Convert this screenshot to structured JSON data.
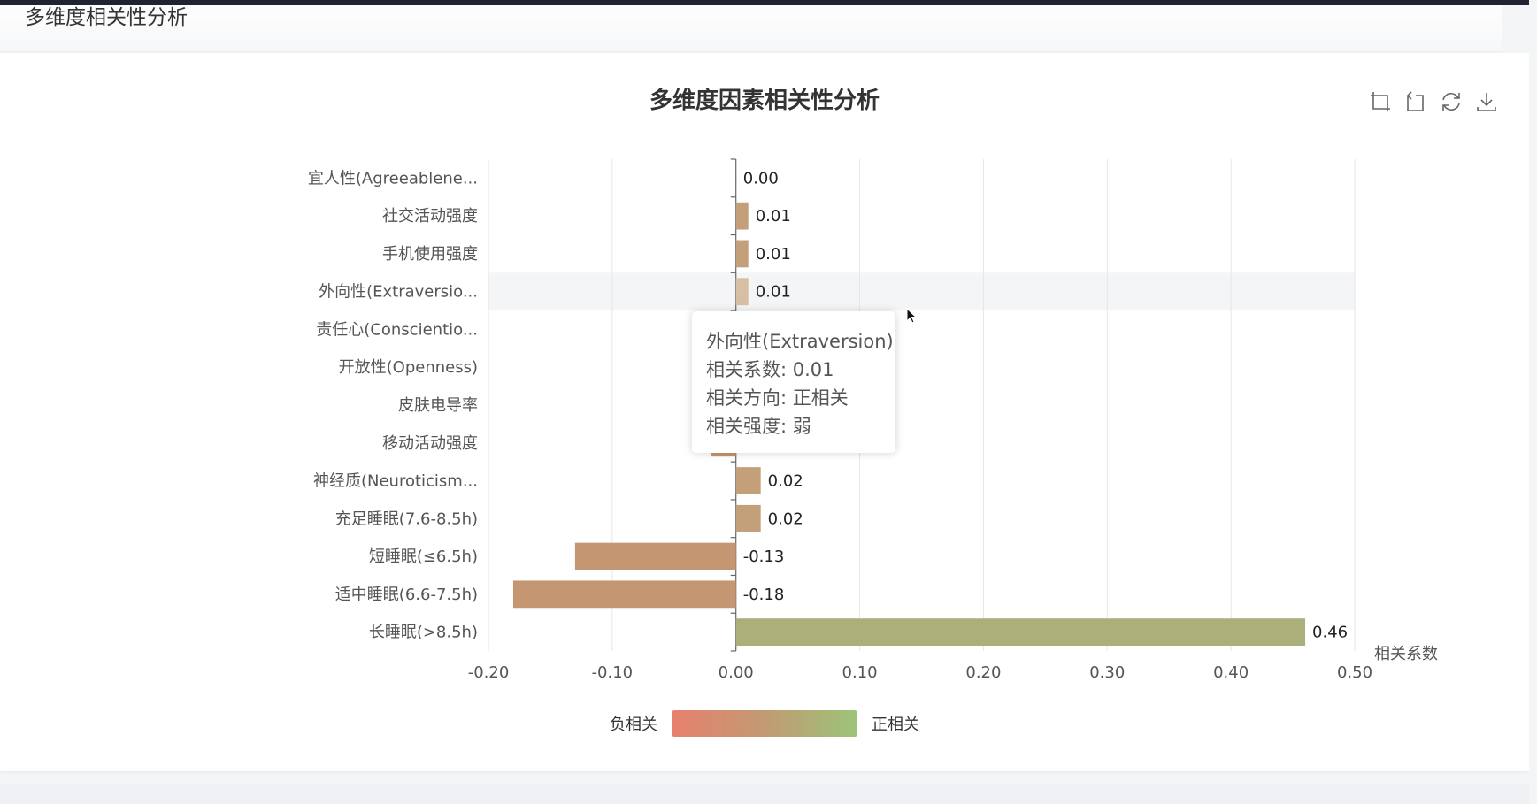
{
  "page": {
    "section_title": "多维度相关性分析"
  },
  "toolbox": [
    {
      "name": "zoom-icon"
    },
    {
      "name": "zoom-reset-icon"
    },
    {
      "name": "refresh-icon"
    },
    {
      "name": "download-icon"
    }
  ],
  "tooltip": {
    "title": "外向性(Extraversion)",
    "line1": "相关系数: 0.01",
    "line2": "相关方向: 正相关",
    "line3": "相关强度: 弱"
  },
  "legend": {
    "low_label": "负相关",
    "high_label": "正相关",
    "low_color": "#e8806e",
    "mid_color": "#c29a72",
    "high_color": "#9cc47a"
  },
  "colors": {
    "bar_positive": "#c3a07a",
    "bar_negative": "#c49672",
    "bar_strong_positive": "#abaf79",
    "bar_highlight": "#d8bfa3"
  },
  "chart_data": {
    "type": "bar",
    "orientation": "horizontal",
    "title": "多维度因素相关性分析",
    "xlabel": "相关系数",
    "xlim": [
      -0.2,
      0.5
    ],
    "xticks": [
      "-0.20",
      "-0.10",
      "0.00",
      "0.10",
      "0.20",
      "0.30",
      "0.40",
      "0.50"
    ],
    "xtick_values": [
      -0.2,
      -0.1,
      0.0,
      0.1,
      0.2,
      0.3,
      0.4,
      0.5
    ],
    "grid": true,
    "highlighted_category": "外向性(Extraversio...",
    "categories": [
      "宜人性(Agreeablene...",
      "社交活动强度",
      "手机使用强度",
      "外向性(Extraversio...",
      "责任心(Conscientio...",
      "开放性(Openness)",
      "皮肤电导率",
      "移动活动强度",
      "神经质(Neuroticism...",
      "充足睡眠(7.6-8.5h)",
      "短睡眠(≤6.5h)",
      "适中睡眠(6.6-7.5h)",
      "长睡眠(>8.5h)"
    ],
    "values": [
      0.0,
      0.01,
      0.01,
      0.01,
      0.0,
      0.0,
      0.0,
      -0.02,
      0.02,
      0.02,
      -0.13,
      -0.18,
      0.46
    ],
    "value_labels": [
      "0.00",
      "0.01",
      "0.01",
      "0.01",
      "",
      "",
      "",
      "",
      "0.02",
      "0.02",
      "-0.13",
      "-0.18",
      "0.46"
    ]
  }
}
